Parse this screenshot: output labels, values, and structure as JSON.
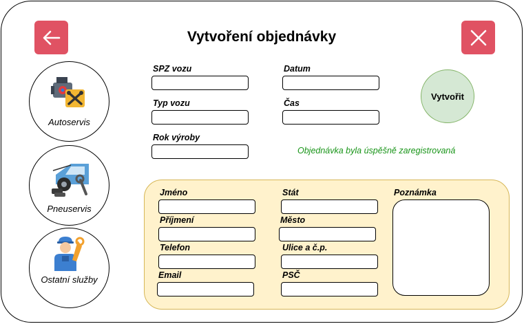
{
  "header": {
    "title": "Vytvoření objednávky",
    "back_icon": "arrow-left-icon",
    "close_icon": "close-icon",
    "button_color": "#e05263"
  },
  "services": [
    {
      "label": "Autoservis",
      "icon": "engine-tools-icon"
    },
    {
      "label": "Pneuservis",
      "icon": "car-tire-service-icon"
    },
    {
      "label": "Ostatní služby",
      "icon": "mechanic-icon"
    }
  ],
  "vehicle": {
    "spz_label": "SPZ vozu",
    "spz_value": "",
    "typ_label": "Typ vozu",
    "typ_value": "",
    "rok_label": "Rok výroby",
    "rok_value": "",
    "datum_label": "Datum",
    "datum_value": "",
    "cas_label": "Čas",
    "cas_value": ""
  },
  "create_button": {
    "label": "Vytvořit",
    "fill": "#d5e8d4",
    "border": "#82b366"
  },
  "status": {
    "message": "Objednávka byla úspěšně zaregistrovaná",
    "color": "#189418"
  },
  "customer": {
    "jmeno_label": "Jméno",
    "jmeno_value": "",
    "prijmeni_label": "Příjmení",
    "prijmeni_value": "",
    "telefon_label": "Telefon",
    "telefon_value": "",
    "email_label": "Email",
    "email_value": "",
    "stat_label": "Stát",
    "stat_value": "",
    "mesto_label": "Město",
    "mesto_value": "",
    "ulice_label": "Ulice a č.p.",
    "ulice_value": "",
    "psc_label": "PSČ",
    "psc_value": "",
    "poznamka_label": "Poznámka",
    "poznamka_value": "",
    "panel_fill": "#fff2cc",
    "panel_border": "#d6b656"
  }
}
